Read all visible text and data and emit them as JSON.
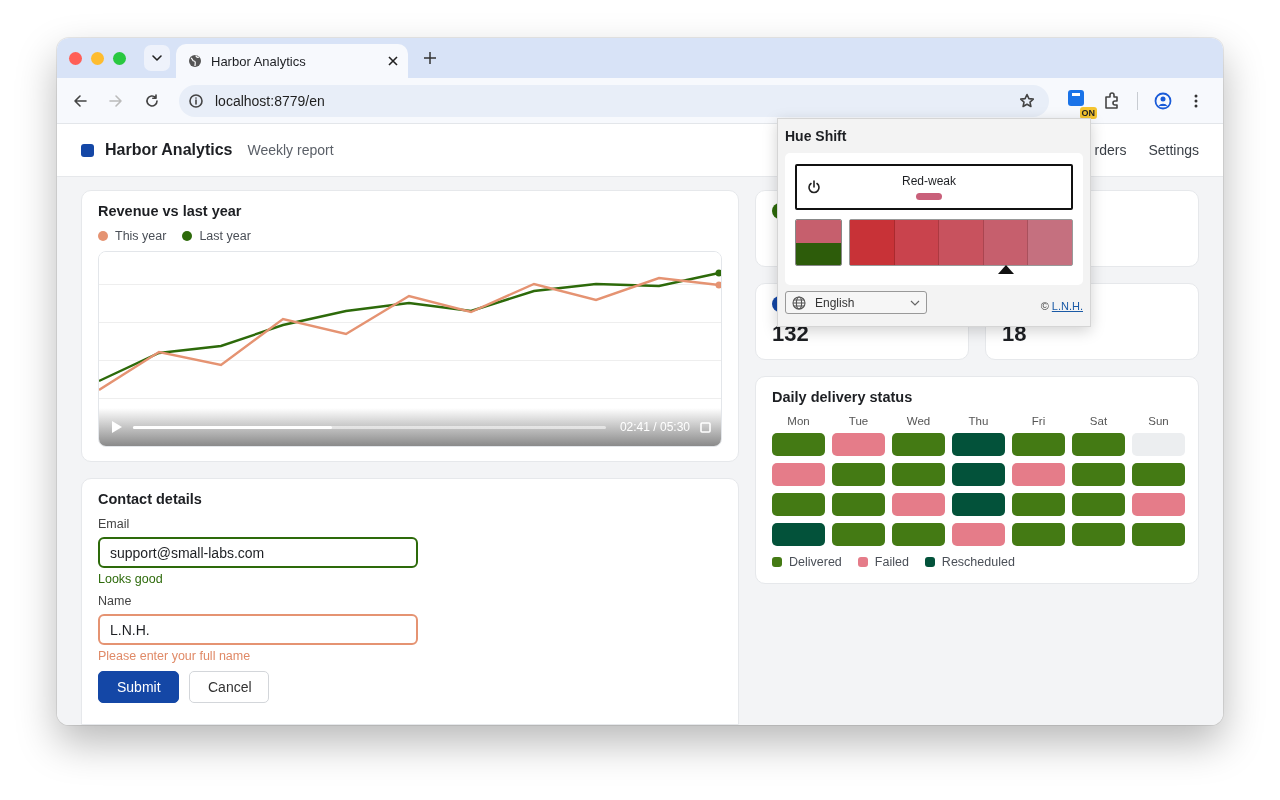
{
  "browser": {
    "tab": {
      "title": "Harbor Analytics",
      "selected": true
    },
    "address": "localhost:8779/en",
    "forward_disabled": true,
    "extension_badge": "ON"
  },
  "header": {
    "brand": "Harbor Analytics",
    "subtitle": "Weekly report",
    "nav": [
      {
        "label": "rders"
      },
      {
        "label": "Settings"
      }
    ]
  },
  "revenue": {
    "title": "Revenue vs last year",
    "legend": [
      {
        "label": "This year",
        "color": "#e59372"
      },
      {
        "label": "Last year",
        "color": "#2d6a0a"
      }
    ],
    "video": {
      "kind": "picture",
      "playing": false,
      "level": 0.42,
      "time": "02:41 / 05:30"
    }
  },
  "contact": {
    "title": "Contact details",
    "fields": [
      {
        "label": "Email",
        "value": "support@small-labs.com",
        "valid": true,
        "message": "Looks good"
      },
      {
        "label": "Name",
        "value": "L.N.H.",
        "valid": false,
        "message": "Please enter your full name"
      }
    ],
    "buttons": [
      {
        "label": "Submit",
        "kind": "primary"
      },
      {
        "label": "Cancel",
        "kind": "secondary"
      }
    ]
  },
  "stats": [
    {
      "kind": "dot",
      "color": "#2d6a0a"
    },
    {
      "kind": "blank"
    },
    {
      "kind": "value",
      "value": "132",
      "color": "#1447a6"
    },
    {
      "kind": "value",
      "value": "18"
    }
  ],
  "delivery": {
    "title": "Daily delivery status",
    "days": [
      "Mon",
      "Tue",
      "Wed",
      "Thu",
      "Fri",
      "Sat",
      "Sun"
    ],
    "weeks": [
      {
        "cells": [
          {
            "color": "#447a14"
          },
          {
            "color": "#e57c89"
          },
          {
            "color": "#447a14"
          },
          {
            "color": "#03523a"
          },
          {
            "color": "#447a14"
          },
          {
            "color": "#447a14"
          },
          {
            "color": "#eceef0"
          }
        ]
      },
      {
        "cells": [
          {
            "color": "#e57c89"
          },
          {
            "color": "#447a14"
          },
          {
            "color": "#447a14"
          },
          {
            "color": "#03523a"
          },
          {
            "color": "#e57c89"
          },
          {
            "color": "#447a14"
          },
          {
            "color": "#447a14"
          }
        ]
      },
      {
        "cells": [
          {
            "color": "#447a14"
          },
          {
            "color": "#447a14"
          },
          {
            "color": "#e57c89"
          },
          {
            "color": "#03523a"
          },
          {
            "color": "#447a14"
          },
          {
            "color": "#447a14"
          },
          {
            "color": "#e57c89"
          }
        ]
      },
      {
        "cells": [
          {
            "color": "#03523a"
          },
          {
            "color": "#447a14"
          },
          {
            "color": "#447a14"
          },
          {
            "color": "#e57c89"
          },
          {
            "color": "#447a14"
          },
          {
            "color": "#447a14"
          },
          {
            "color": "#447a14"
          }
        ]
      }
    ],
    "legend": [
      {
        "label": "Delivered",
        "color": "#447a14"
      },
      {
        "label": "Failed",
        "color": "#e57c89"
      },
      {
        "label": "Rescheduled",
        "color": "#03523a"
      }
    ]
  },
  "popup": {
    "title": "Hue Shift",
    "mode": {
      "label": "Red-weak",
      "color": "#c9607a"
    },
    "on": true,
    "swatches": [
      {
        "color": "#c83237",
        "selected": false
      },
      {
        "color": "#c9434d",
        "selected": false
      },
      {
        "color": "#c8525e",
        "selected": false
      },
      {
        "color": "#c65f6d",
        "selected": true
      },
      {
        "color": "#c5707f",
        "selected": false
      }
    ],
    "language": "English",
    "credit": "©",
    "credit_link": "L.N.H."
  }
}
